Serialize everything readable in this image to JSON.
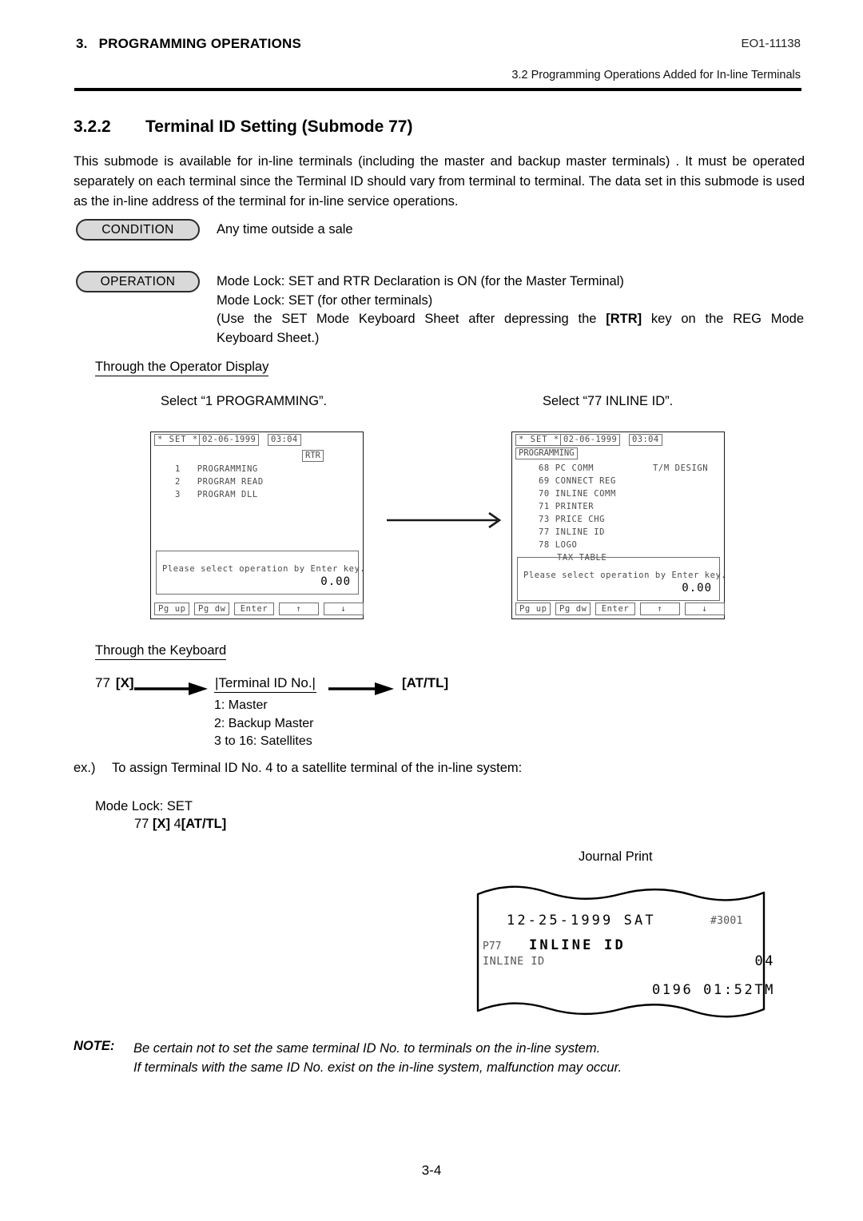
{
  "header": {
    "chapter_number": "3.",
    "chapter_title": "PROGRAMMING OPERATIONS",
    "doc_code": "EO1-11138",
    "section_ref": "3.2  Programming Operations Added for In-line Terminals"
  },
  "section": {
    "number": "3.2.2",
    "title": "Terminal ID Setting (Submode 77)",
    "intro": "This submode is available for in-line terminals (including the master and backup master terminals) . It must be operated separately on each terminal since the Terminal ID should vary from terminal to terminal. The data set in this submode is used as the in-line address of the terminal for in-line service operations."
  },
  "condition": {
    "label": "CONDITION",
    "text": "Any time outside a sale"
  },
  "operation": {
    "label": "OPERATION",
    "line1": "Mode Lock:  SET and RTR Declaration is ON (for the Master Terminal)",
    "line2": "Mode Lock:  SET (for other terminals)",
    "line3_a": "(Use the SET Mode Keyboard Sheet after depressing the ",
    "line3_key": "[RTR]",
    "line3_b": " key on the REG Mode",
    "line4": "Keyboard Sheet.)"
  },
  "operator_display": {
    "subhead": "Through the Operator Display",
    "select_left": "Select “1 PROGRAMMING”.",
    "select_right": "Select “77 INLINE ID”.",
    "left_screen": {
      "mode": "* SET *",
      "date": "02-06-1999",
      "time": "03:04",
      "rtr": "RTR",
      "menu": [
        {
          "index": "1",
          "label": "PROGRAMMING"
        },
        {
          "index": "2",
          "label": "PROGRAM READ"
        },
        {
          "index": "3",
          "label": "PROGRAM DLL"
        }
      ],
      "message": "Please select operation by Enter key.",
      "amount": "0.00",
      "keys": [
        "Pg up",
        "Pg dw",
        "Enter",
        "↑",
        "↓"
      ]
    },
    "right_screen": {
      "mode": "* SET *",
      "date": "02-06-1999",
      "time": "03:04",
      "breadcrumb": "PROGRAMMING",
      "menu": [
        {
          "index": "68",
          "label": "PC COMM",
          "right": "T/M DESIGN"
        },
        {
          "index": "69",
          "label": "CONNECT REG",
          "right": ""
        },
        {
          "index": "70",
          "label": "INLINE COMM",
          "right": ""
        },
        {
          "index": "71",
          "label": "PRINTER",
          "right": ""
        },
        {
          "index": "73",
          "label": "PRICE CHG",
          "right": ""
        },
        {
          "index": "77",
          "label": "INLINE ID",
          "right": ""
        },
        {
          "index": "78",
          "label": "LOGO",
          "right": ""
        },
        {
          "index": "",
          "label": "TAX TABLE",
          "right": ""
        }
      ],
      "message": "Please select operation by Enter key.",
      "amount": "0.00",
      "keys": [
        "Pg up",
        "Pg dw",
        "Enter",
        "↑",
        "↓"
      ]
    }
  },
  "keyboard_flow": {
    "subhead": "Through the Keyboard",
    "step1_num": "77",
    "step1_key": "[X]",
    "step2": "|Terminal ID No.|",
    "step3": "[AT/TL]",
    "id_list": [
      "1:  Master",
      "2:  Backup Master",
      "3 to 16:  Satellites"
    ]
  },
  "example": {
    "prefix": "ex.)",
    "text": "To assign Terminal ID No. 4 to a satellite terminal of the in-line system:",
    "mode_lock": "Mode Lock:  SET",
    "keys_num": "77",
    "keys_x": "[X]",
    "keys_val": "4",
    "keys_attl": "[AT/TL]",
    "journal_label": "Journal Print"
  },
  "receipt": {
    "date": "12-25-1999 SAT",
    "reg_no": "#3001",
    "prog_code": "P77",
    "title": "INLINE ID",
    "item_label": "INLINE ID",
    "item_value": "04",
    "footer": "0196 01:52TM"
  },
  "note": {
    "label": "NOTE:",
    "line1": "Be certain not to set the same terminal ID No. to terminals on the in-line system.",
    "line2": "If terminals with the same ID No. exist on the in-line system, malfunction may occur."
  },
  "page_number": "3-4"
}
